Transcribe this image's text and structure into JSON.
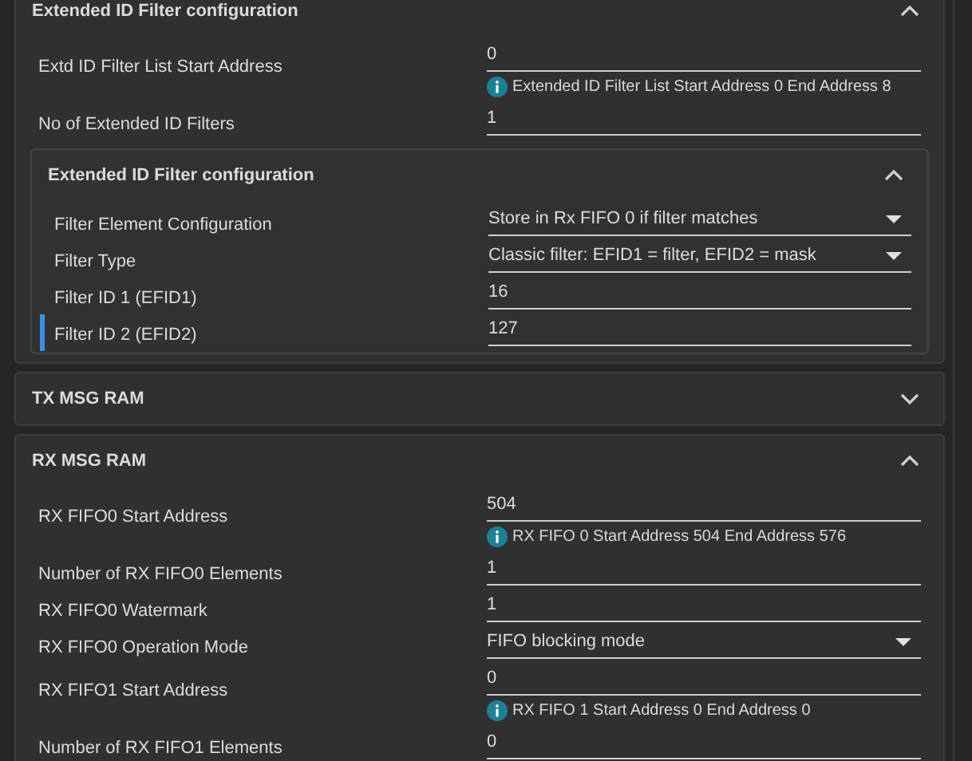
{
  "sections": [
    {
      "title": "Extended ID Filter configuration",
      "expanded": true,
      "fields": [
        {
          "kind": "text",
          "label": "Extd ID Filter List Start Address",
          "value": "0",
          "hint": "Extended ID Filter List Start Address 0 End Address 8",
          "focused": false
        },
        {
          "kind": "text",
          "label": "No of Extended ID Filters",
          "value": "1",
          "focused": false
        }
      ],
      "subsections": [
        {
          "title": "Extended ID Filter configuration",
          "expanded": true,
          "fields": [
            {
              "kind": "select",
              "label": "Filter Element Configuration",
              "value": "Store in Rx FIFO 0 if filter matches",
              "focused": false
            },
            {
              "kind": "select",
              "label": "Filter Type",
              "value": "Classic filter: EFID1 = filter, EFID2 = mask",
              "focused": false
            },
            {
              "kind": "text",
              "label": "Filter ID 1 (EFID1)",
              "value": "16",
              "focused": false
            },
            {
              "kind": "text",
              "label": "Filter ID 2 (EFID2)",
              "value": "127",
              "focused": true
            }
          ]
        }
      ]
    },
    {
      "title": "TX MSG RAM",
      "expanded": false
    },
    {
      "title": "RX MSG RAM",
      "expanded": true,
      "fields": [
        {
          "kind": "text",
          "label": "RX FIFO0 Start Address",
          "value": "504",
          "hint": "RX FIFO 0 Start Address 504 End Address 576",
          "focused": false
        },
        {
          "kind": "text",
          "label": "Number of RX FIFO0 Elements",
          "value": "1",
          "focused": false
        },
        {
          "kind": "text",
          "label": "RX FIFO0 Watermark",
          "value": "1",
          "focused": false
        },
        {
          "kind": "select",
          "label": "RX FIFO0 Operation Mode",
          "value": "FIFO blocking mode",
          "focused": false
        },
        {
          "kind": "text",
          "label": "RX FIFO1 Start Address",
          "value": "0",
          "hint": "RX FIFO 1 Start Address 0 End Address 0",
          "focused": false
        },
        {
          "kind": "text",
          "label": "Number of RX FIFO1 Elements",
          "value": "0",
          "focused": false
        }
      ]
    }
  ]
}
